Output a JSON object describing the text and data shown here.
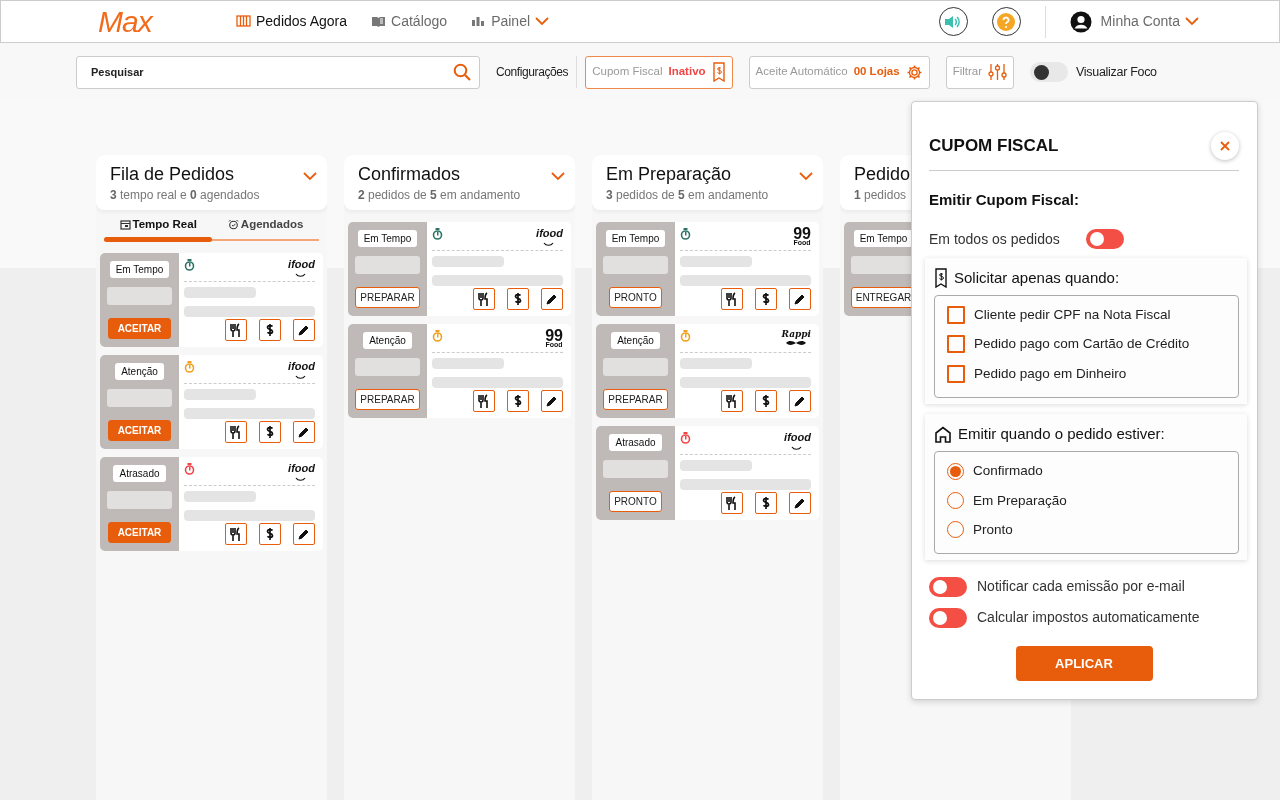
{
  "nav": {
    "logo": "Max",
    "items": [
      {
        "label": "Pedidos Agora",
        "selected": true,
        "dropdown": false
      },
      {
        "label": "Catálogo",
        "selected": false,
        "dropdown": false
      },
      {
        "label": "Painel",
        "selected": false,
        "dropdown": true
      }
    ],
    "account": "Minha Conta"
  },
  "toolbar": {
    "search": {
      "placeholder": "Pesquisar"
    },
    "settings": "Configurações",
    "cupom": {
      "label": "Cupom Fiscal",
      "status": "Inativo"
    },
    "aceite": {
      "label": "Aceite Automático",
      "value": "00 Lojas"
    },
    "filter": "Filtrar",
    "focus": {
      "label": "Visualizar Foco",
      "on": false
    }
  },
  "columns": [
    {
      "title": "Fila de Pedidos",
      "subtitle": "**3** tempo real e **0** agendados",
      "tabs": [
        {
          "label": "Tempo Real",
          "selected": true
        },
        {
          "label": "Agendados",
          "selected": false
        }
      ],
      "cards": [
        {
          "status": "Em Tempo",
          "color": "#2e7466",
          "action": {
            "label": "ACEITAR",
            "kind": "filled"
          },
          "logo": {
            "kind": "ifood",
            "text": "ifood"
          }
        },
        {
          "status": "Atenção",
          "color": "#f0a020",
          "action": {
            "label": "ACEITAR",
            "kind": "filled"
          },
          "logo": {
            "kind": "ifood",
            "text": "ifood"
          }
        },
        {
          "status": "Atrasado",
          "color": "#f04646",
          "action": {
            "label": "ACEITAR",
            "kind": "filled"
          },
          "logo": {
            "kind": "ifood",
            "text": "ifood"
          }
        }
      ]
    },
    {
      "title": "Confirmados",
      "subtitle": "**2** pedidos de **5** em andamento",
      "cards": [
        {
          "status": "Em Tempo",
          "color": "#2e7466",
          "action": {
            "label": "PREPARAR",
            "kind": "outline"
          },
          "logo": {
            "kind": "ifood",
            "text": "ifood"
          }
        },
        {
          "status": "Atenção",
          "color": "#f0a020",
          "action": {
            "label": "PREPARAR",
            "kind": "outline"
          },
          "logo": {
            "kind": "ninetynine",
            "text": "99",
            "sub": "Food"
          }
        }
      ]
    },
    {
      "title": "Em Preparação",
      "subtitle": "**3** pedidos de **5** em andamento",
      "cards": [
        {
          "status": "Em Tempo",
          "color": "#2e7466",
          "action": {
            "label": "PRONTO",
            "kind": "outline"
          },
          "logo": {
            "kind": "ninetynine",
            "text": "99",
            "sub": "Food"
          }
        },
        {
          "status": "Atenção",
          "color": "#f0a020",
          "action": {
            "label": "PREPARAR",
            "kind": "outline"
          },
          "logo": {
            "kind": "rappi",
            "text": "Rappi"
          }
        },
        {
          "status": "Atrasado",
          "color": "#f04646",
          "action": {
            "label": "PRONTO",
            "kind": "outline"
          },
          "logo": {
            "kind": "ifood",
            "text": "ifood"
          }
        }
      ]
    },
    {
      "title": "Pedido",
      "subtitle": "**1** pedidos",
      "cards": [
        {
          "status": "Em Tempo",
          "action": {
            "label": "ENTREGAR",
            "kind": "outline"
          }
        }
      ]
    }
  ],
  "panel": {
    "title": "CUPOM FISCAL",
    "heading": "Emitir Cupom Fiscal:",
    "all_orders": {
      "label": "Em todos os pedidos",
      "on": false
    },
    "conditions": {
      "title": "Solicitar apenas quando:",
      "items": [
        {
          "label": "Cliente pedir CPF na Nota Fiscal",
          "checked": false
        },
        {
          "label": "Pedido pago com Cartão de Crédito",
          "checked": false
        },
        {
          "label": "Pedido pago em Dinheiro",
          "checked": false
        }
      ]
    },
    "stage": {
      "title": "Emitir quando o pedido estiver:",
      "options": [
        {
          "label": "Confirmado",
          "selected": true
        },
        {
          "label": "Em Preparação",
          "selected": false
        },
        {
          "label": "Pronto",
          "selected": false
        }
      ]
    },
    "switches": [
      {
        "label": "Notificar cada emissão por e-mail",
        "on": false
      },
      {
        "label": "Calcular impostos automaticamente",
        "on": false
      }
    ],
    "apply": "APLICAR"
  }
}
